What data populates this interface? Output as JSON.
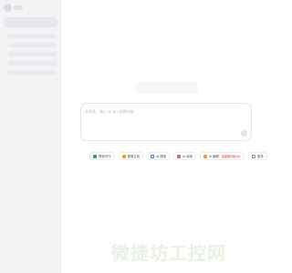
{
  "sidebar": {
    "items": [
      "",
      "",
      "",
      "",
      ""
    ]
  },
  "input": {
    "placeholder": "发消息、输入 @ 或 / 选择技能"
  },
  "chips": [
    {
      "label": "帮我写作",
      "icon": "pen-icon",
      "color": "#3aa55a"
    },
    {
      "label": "图像生成",
      "icon": "image-icon",
      "color": "#f0a020"
    },
    {
      "label": "AI 搜索",
      "icon": "search-icon",
      "color": "#4a7bf7"
    },
    {
      "label": "AI 阅读",
      "icon": "book-icon",
      "color": "#e85d8a"
    },
    {
      "label": "AI 编程",
      "icon": "code-icon",
      "color": "#f0a020",
      "badge": "桌面端升级 5.0"
    },
    {
      "label": "更多",
      "icon": "more-icon",
      "color": "#8a8f97"
    }
  ],
  "watermark": "微捷坊工控网"
}
